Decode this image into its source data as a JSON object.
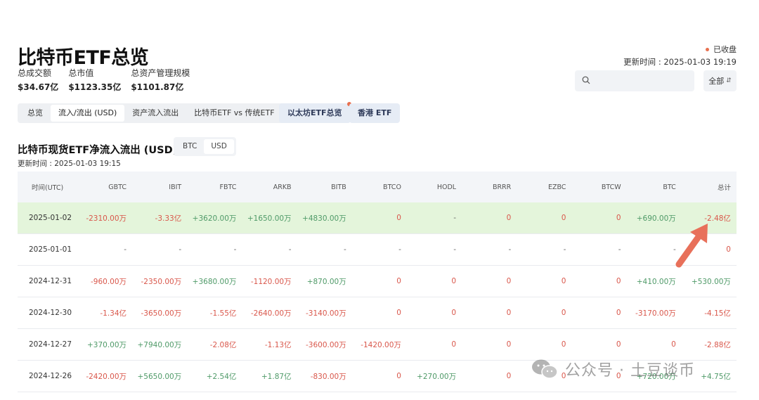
{
  "header": {
    "title": "比特币ETF总览",
    "metrics": [
      {
        "label": "总成交额",
        "value": "$34.67亿"
      },
      {
        "label": "总市值",
        "value": "$1123.35亿"
      },
      {
        "label": "总资产管理规模",
        "value": "$1101.87亿"
      }
    ],
    "status": "已收盘",
    "updated": "更新时间 : 2025-01-03 19:19",
    "select_value": "全部"
  },
  "tabs": {
    "group": [
      "总览",
      "流入/流出 (USD)",
      "资产流入流出",
      "比特币ETF vs 传统ETF"
    ],
    "active_index": 1,
    "pill1": "以太坊ETF总览",
    "pill2": "香港 ETF"
  },
  "section": {
    "title": "比特币现货ETF净流入流出 (USD)",
    "toggle": [
      "BTC",
      "USD"
    ],
    "toggle_active": "USD",
    "updated": "更新时间 : 2025-01-03 19:15"
  },
  "table": {
    "columns": [
      "时间(UTC)",
      "GBTC",
      "IBIT",
      "FBTC",
      "ARKB",
      "BITB",
      "BTCO",
      "HODL",
      "BRRR",
      "EZBC",
      "BTCW",
      "BTC",
      "总计"
    ],
    "rows": [
      {
        "highlight": true,
        "cells": [
          "2025-01-02",
          "-2310.00万",
          "-3.33亿",
          "+3620.00万",
          "+1650.00万",
          "+4830.00万",
          "0",
          "-",
          "0",
          "0",
          "0",
          "+690.00万",
          "-2.48亿"
        ]
      },
      {
        "highlight": false,
        "cells": [
          "2025-01-01",
          "-",
          "-",
          "-",
          "-",
          "-",
          "-",
          "-",
          "-",
          "-",
          "-",
          "-",
          "0"
        ]
      },
      {
        "highlight": false,
        "cells": [
          "2024-12-31",
          "-960.00万",
          "-2350.00万",
          "+3680.00万",
          "-1120.00万",
          "+870.00万",
          "0",
          "0",
          "0",
          "0",
          "0",
          "+410.00万",
          "+530.00万"
        ]
      },
      {
        "highlight": false,
        "cells": [
          "2024-12-30",
          "-1.34亿",
          "-3650.00万",
          "-1.55亿",
          "-2640.00万",
          "-3140.00万",
          "0",
          "0",
          "0",
          "0",
          "0",
          "-3170.00万",
          "-4.15亿"
        ]
      },
      {
        "highlight": false,
        "cells": [
          "2024-12-27",
          "+370.00万",
          "+7940.00万",
          "-2.08亿",
          "-1.13亿",
          "-3600.00万",
          "-1420.00万",
          "0",
          "0",
          "0",
          "0",
          "0",
          "-2.88亿"
        ]
      },
      {
        "highlight": false,
        "cells": [
          "2024-12-26",
          "-2420.00万",
          "+5650.00万",
          "+2.54亿",
          "+1.87亿",
          "-830.00万",
          "0",
          "+270.00万",
          "0",
          "0",
          "0",
          "+720.00万",
          "+4.75亿"
        ]
      }
    ]
  },
  "watermark": "公众号 · 土豆谈币",
  "colors": {
    "positive": "#4f9a68",
    "negative": "#d9574b",
    "highlight_row": "#e4f5db",
    "arrow": "#e8705a",
    "status_dot": "#e8704f"
  }
}
